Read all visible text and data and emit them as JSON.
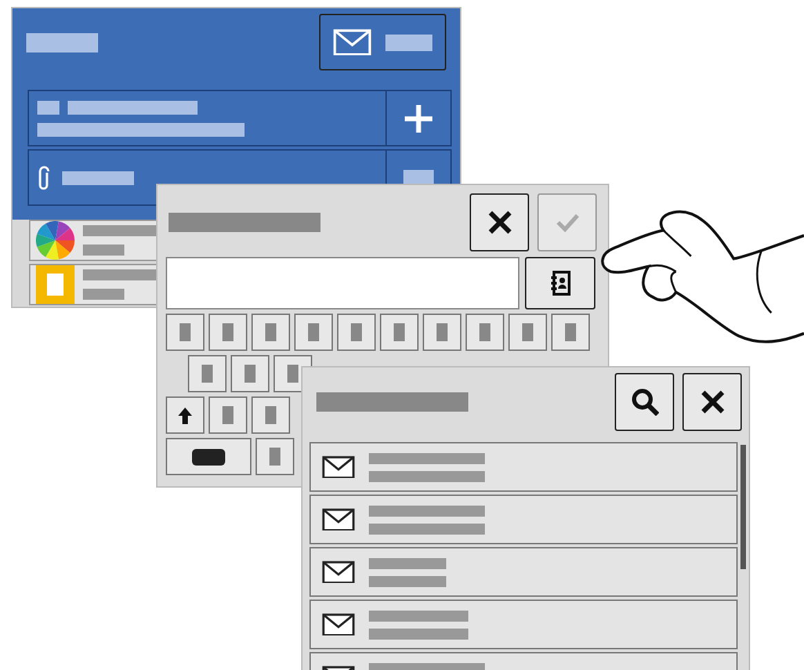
{
  "email_screen": {
    "items": [
      {
        "kind": "palette"
      },
      {
        "kind": "document"
      }
    ]
  },
  "address_screen": {
    "confirm_disabled": true,
    "keyboard_rows": [
      {
        "keys": [
          {
            "kind": "char"
          },
          {
            "kind": "char"
          },
          {
            "kind": "char"
          },
          {
            "kind": "char"
          },
          {
            "kind": "char"
          },
          {
            "kind": "char"
          },
          {
            "kind": "char"
          },
          {
            "kind": "char"
          },
          {
            "kind": "char"
          },
          {
            "kind": "char"
          }
        ]
      },
      {
        "keys": [
          {
            "kind": "char"
          },
          {
            "kind": "char"
          },
          {
            "kind": "char"
          }
        ]
      },
      {
        "keys": [
          {
            "kind": "shift"
          },
          {
            "kind": "char"
          },
          {
            "kind": "char"
          }
        ]
      },
      {
        "keys": [
          {
            "kind": "space"
          },
          {
            "kind": "char"
          }
        ]
      }
    ]
  },
  "contacts_screen": {
    "rows": [
      {
        "kind": "email"
      },
      {
        "kind": "email"
      },
      {
        "kind": "email"
      },
      {
        "kind": "email"
      },
      {
        "kind": "email"
      }
    ]
  }
}
